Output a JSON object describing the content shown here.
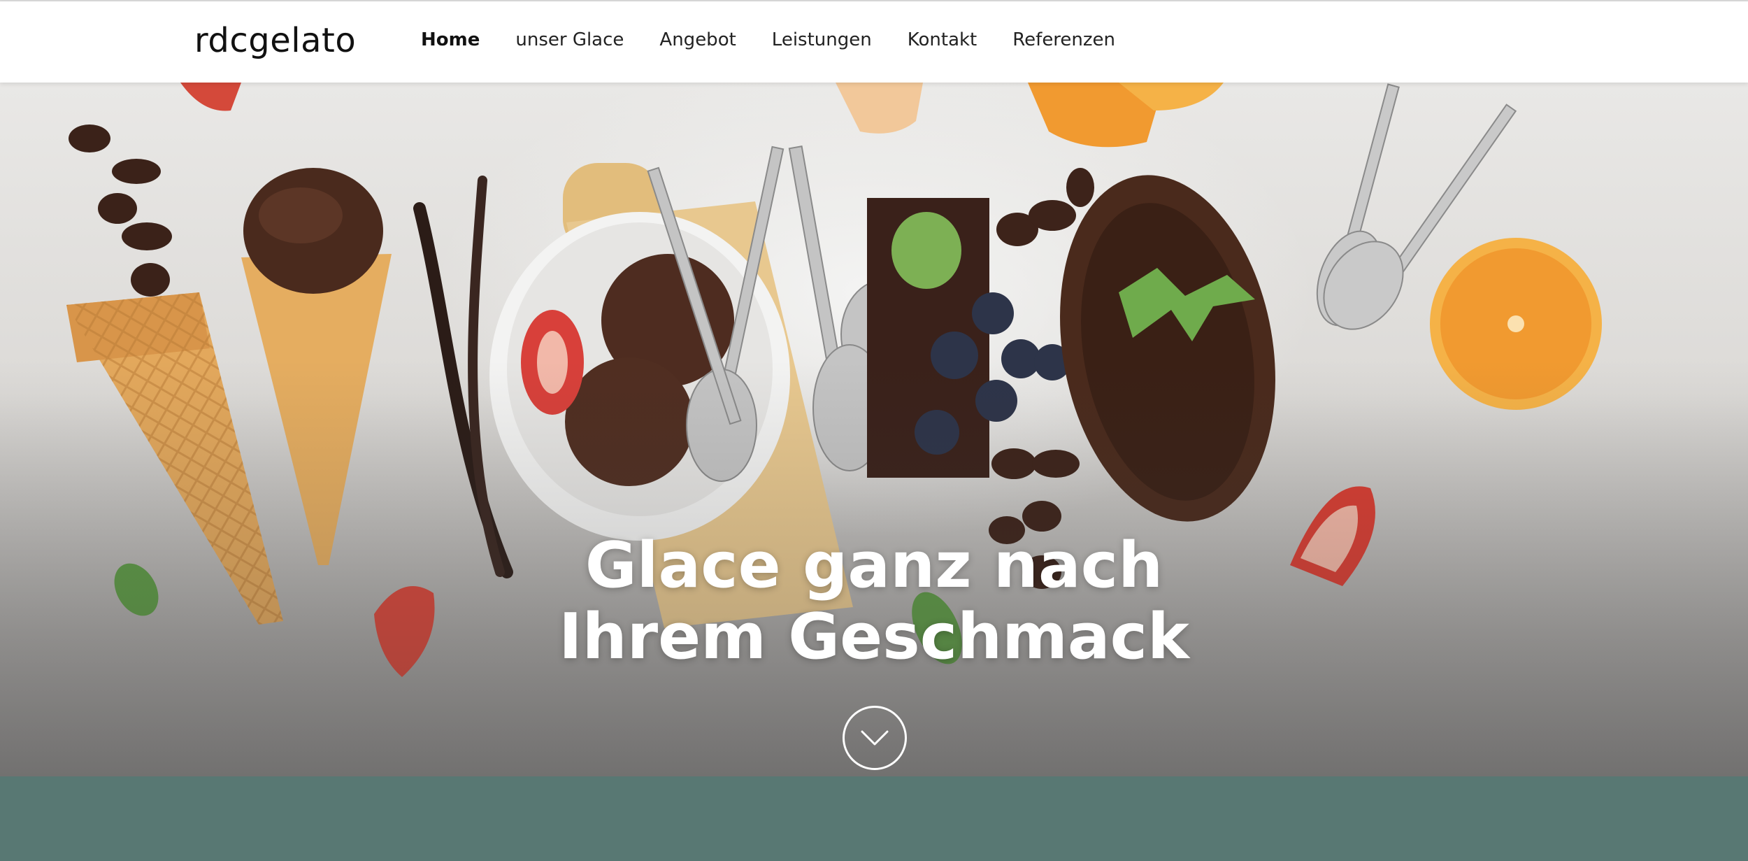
{
  "brand": {
    "logo_text": "rdcgelato"
  },
  "nav": {
    "items": [
      {
        "label": "Home",
        "active": true
      },
      {
        "label": "unser Glace",
        "active": false
      },
      {
        "label": "Angebot",
        "active": false
      },
      {
        "label": "Leistungen",
        "active": false
      },
      {
        "label": "Kontakt",
        "active": false
      },
      {
        "label": "Referenzen",
        "active": false
      }
    ]
  },
  "hero": {
    "headline_line1": "Glace ganz nach",
    "headline_line2": "Ihrem Geschmack",
    "scroll_icon": "chevron-down-icon"
  },
  "colors": {
    "band": "#587873",
    "header_bg": "#ffffff",
    "headline": "#ffffff"
  }
}
